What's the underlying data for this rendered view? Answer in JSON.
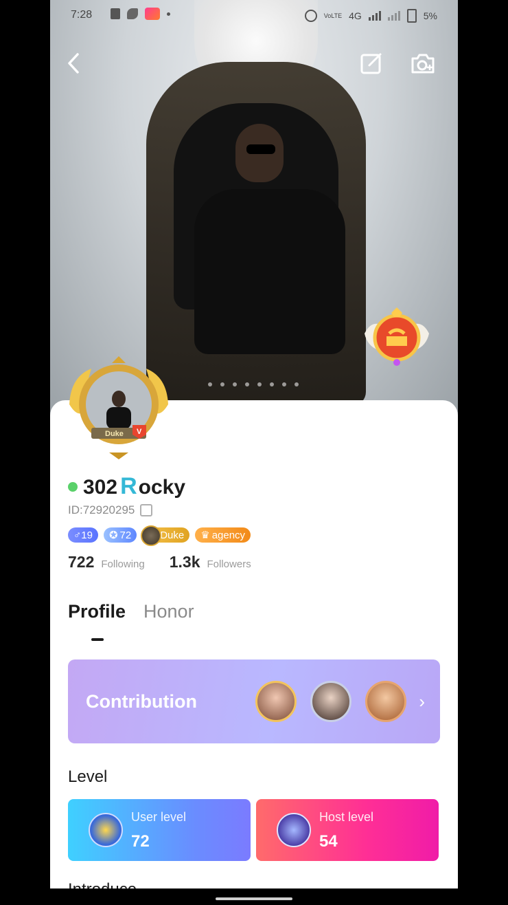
{
  "status_bar": {
    "time": "7:28",
    "network": "4G",
    "battery": "5%"
  },
  "header": {
    "back_icon": "chevron-left-icon",
    "edit_icon": "edit-icon",
    "camera_icon": "camera-plus-icon"
  },
  "profile": {
    "name_prefix": "302",
    "name_initial": "R",
    "name_rest": "ocky",
    "id_label": "ID:72920295",
    "online_color": "#5ad16a",
    "frame_badge": "Duke",
    "frame_v": "V"
  },
  "badges": {
    "gender": "♂19",
    "level": "72",
    "duke": "Duke",
    "agency": "agency"
  },
  "stats": {
    "following_count": "722",
    "following_label": "Following",
    "followers_count": "1.3k",
    "followers_label": "Followers"
  },
  "tabs": {
    "profile": "Profile",
    "honor": "Honor"
  },
  "contribution": {
    "title": "Contribution",
    "chevron": "›"
  },
  "level": {
    "heading": "Level",
    "user_label": "User level",
    "user_value": "72",
    "host_label": "Host level",
    "host_value": "54"
  },
  "introduce": {
    "heading": "Introduce"
  }
}
